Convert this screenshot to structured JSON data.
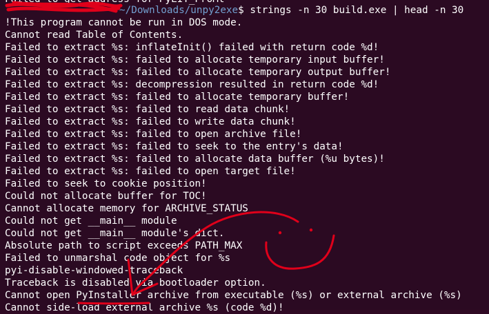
{
  "terminal": {
    "partial_top_line": "Failed to get address for PyLIT_ProMt",
    "prompt": {
      "user": "",
      "path": "~/Downloads/unpy2exe",
      "symbol": "$",
      "command": "strings -n 30 build.exe | head -n 30"
    },
    "lines": [
      "!This program cannot be run in DOS mode.",
      "Cannot read Table of Contents.",
      "Failed to extract %s: inflateInit() failed with return code %d!",
      "Failed to extract %s: failed to allocate temporary input buffer!",
      "Failed to extract %s: failed to allocate temporary output buffer!",
      "Failed to extract %s: decompression resulted in return code %d!",
      "Failed to extract %s: failed to allocate temporary buffer!",
      "Failed to extract %s: failed to read data chunk!",
      "Failed to extract %s: failed to write data chunk!",
      "Failed to extract %s: failed to open archive file!",
      "Failed to extract %s: failed to seek to the entry's data!",
      "Failed to extract %s: failed to allocate data buffer (%u bytes)!",
      "Failed to extract %s: failed to open target file!",
      "Failed to seek to cookie position!",
      "Could not allocate buffer for TOC!",
      "Cannot allocate memory for ARCHIVE_STATUS",
      "Could not get __main__ module",
      "Could not get __main__ module's dict.",
      "Absolute path to script exceeds PATH_MAX",
      "Failed to unmarshal code object for %s",
      "pyi-disable-windowed-traceback",
      "Traceback is disabled via bootloader option.",
      "Cannot open PyInstaller archive from executable (%s) or external archive (%s)",
      "Cannot side-load external archive %s (code %d)!"
    ]
  },
  "colors": {
    "background": "#2b0a22",
    "text": "#ffffff",
    "prompt_user": "#8ae234",
    "prompt_path": "#729fcf",
    "annotation": "#e0001a"
  }
}
